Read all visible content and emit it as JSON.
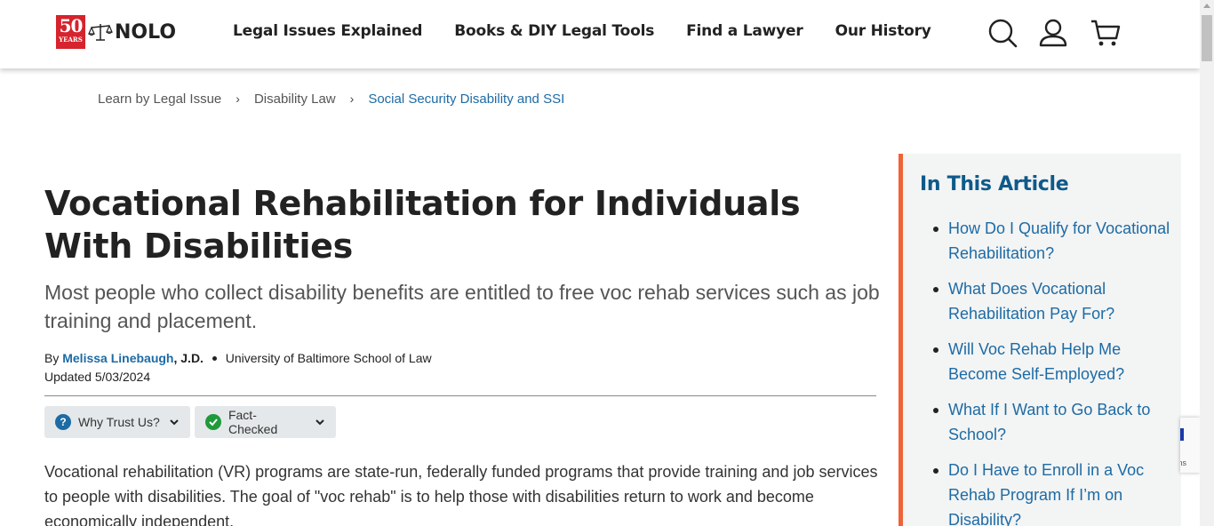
{
  "header": {
    "logo": {
      "years_number": "50",
      "years_label": "YEARS",
      "brand": "NOLO"
    },
    "nav": [
      {
        "label": "Legal Issues Explained"
      },
      {
        "label": "Books & DIY Legal Tools"
      },
      {
        "label": "Find a Lawyer"
      },
      {
        "label": "Our History"
      }
    ],
    "icons": [
      "search-icon",
      "account-icon",
      "cart-icon"
    ]
  },
  "breadcrumb": [
    {
      "label": "Learn by Legal Issue"
    },
    {
      "label": "Disability Law"
    },
    {
      "label": "Social Security Disability and SSI"
    }
  ],
  "article": {
    "title": "Vocational Rehabilitation for Individuals With Disabilities",
    "subtitle": "Most people who collect disability benefits are entitled to free voc rehab services such as job training and placement.",
    "byline_prefix": "By",
    "author": "Melissa Linebaugh",
    "credential": ", J.D.",
    "school": "University of Baltimore School of Law",
    "updated": "Updated 5/03/2024",
    "trust_label": "Why Trust Us?",
    "fact_label": "Fact-Checked",
    "intro": "Vocational rehabilitation (VR) programs are state-run, federally funded programs that provide training and job services to people with disabilities. The goal of \"voc rehab\" is to help those with disabilities return to work and become economically independent."
  },
  "toc": {
    "title": "In This Article",
    "items": [
      {
        "label": "How Do I Qualify for Vocational Rehabilitation?"
      },
      {
        "label": "What Does Vocational Rehabilitation Pay For?"
      },
      {
        "label": "Will Voc Rehab Help Me Become Self-Employed?"
      },
      {
        "label": "What If I Want to Go Back to School?"
      },
      {
        "label": "Do I Have to Enroll in a Voc Rehab Program If I’m on Disability?"
      }
    ]
  },
  "recaptcha": {
    "text": "rms"
  },
  "colors": {
    "accent_orange": "#ef6337",
    "link_blue": "#1d6ba5",
    "toc_title": "#0e5a8a",
    "logo_red": "#d6232d"
  }
}
